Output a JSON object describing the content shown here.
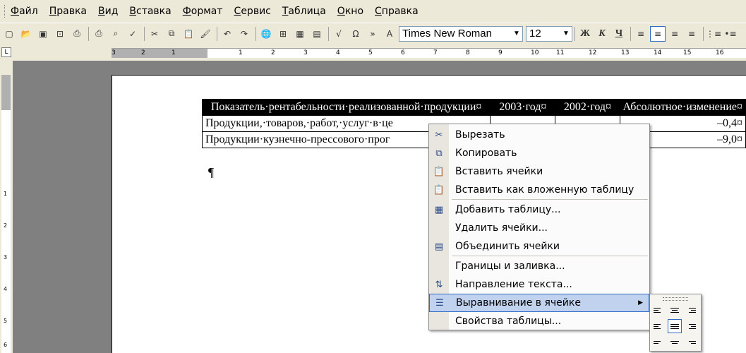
{
  "menubar": {
    "items": [
      "Файл",
      "Правка",
      "Вид",
      "Вставка",
      "Формат",
      "Сервис",
      "Таблица",
      "Окно",
      "Справка"
    ]
  },
  "toolbar": {
    "font_name": "Times New Roman",
    "font_size": "12",
    "bold": "Ж",
    "italic": "К",
    "underline": "Ч"
  },
  "ruler": {
    "ticks": [
      "3",
      "2",
      "1",
      "1",
      "2",
      "3",
      "4",
      "5",
      "6",
      "7",
      "8",
      "9",
      "10",
      "11",
      "12",
      "13",
      "14",
      "15",
      "16"
    ]
  },
  "vruler": {
    "ticks": [
      "1",
      "2",
      "3",
      "4",
      "5",
      "6",
      "7"
    ]
  },
  "table": {
    "header": [
      "Показатель·рентабельности·реализованной·продукции¤",
      "2003·год¤",
      "2002·год¤",
      "Абсолютное·изменение¤"
    ],
    "rows": [
      [
        "Продукции,·товаров,·работ,·услуг·в·це",
        "",
        "",
        "–0,4¤"
      ],
      [
        "Продукции·кузнечно-прессового·прог",
        "",
        "",
        "–9,0¤"
      ]
    ],
    "pilcrow": "¶"
  },
  "context_menu": {
    "items": [
      {
        "label": "Вырезать",
        "icon": "scissors-icon"
      },
      {
        "label": "Копировать",
        "icon": "copy-icon"
      },
      {
        "label": "Вставить ячейки",
        "icon": "paste-icon"
      },
      {
        "label": "Вставить как вложенную таблицу",
        "icon": "paste-nested-icon"
      },
      {
        "label": "Добавить таблицу...",
        "icon": "table-icon"
      },
      {
        "label": "Удалить ячейки...",
        "icon": ""
      },
      {
        "label": "Объединить ячейки",
        "icon": "merge-cells-icon"
      },
      {
        "label": "Границы и заливка...",
        "icon": ""
      },
      {
        "label": "Направление текста...",
        "icon": "text-direction-icon"
      },
      {
        "label": "Выравнивание в ячейке",
        "icon": "cell-align-icon",
        "submenu": true
      },
      {
        "label": "Свойства таблицы...",
        "icon": ""
      }
    ]
  },
  "colors": {
    "highlight": "#c1d2ee",
    "highlight_border": "#316ac5",
    "chrome": "#ece9d8"
  }
}
